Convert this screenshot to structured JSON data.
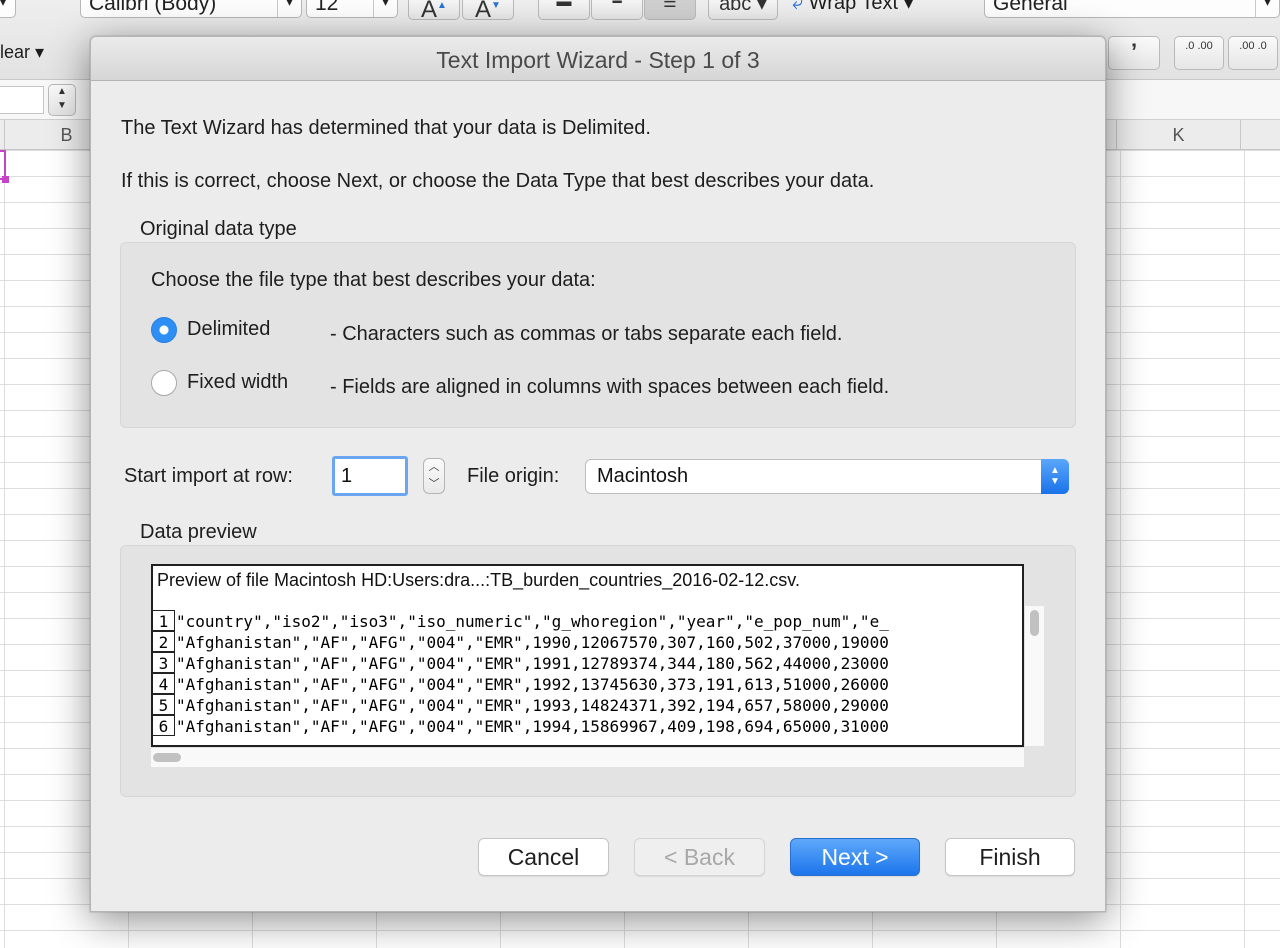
{
  "excel": {
    "ribbon": {
      "font_name": "Calibri (Body)",
      "font_size": "12",
      "grow_font": "A",
      "shrink_font": "A",
      "spelling": "abc",
      "wrap_text": "Wrap Text",
      "number_format": "General",
      "clear": "lear",
      "comma_style": "’",
      "increase_decimal": ".0 .00",
      "decrease_decimal": ".00 .0"
    },
    "column_headers": [
      "B",
      "K"
    ]
  },
  "dialog": {
    "title": "Text Import Wizard - Step 1 of 3",
    "intro_1": "The Text Wizard has determined that your data is Delimited.",
    "intro_2": "If this is correct, choose Next, or choose the Data Type that best describes your data.",
    "original_type": {
      "heading": "Original data type",
      "prompt": "Choose the file type that best describes your data:",
      "options": [
        {
          "label": "Delimited",
          "description": "- Characters such as commas or tabs separate each field.",
          "selected": true
        },
        {
          "label": "Fixed width",
          "description": "- Fields are aligned in columns with spaces between each field.",
          "selected": false
        }
      ]
    },
    "start_row": {
      "label": "Start import at row:",
      "value": "1"
    },
    "file_origin": {
      "label": "File origin:",
      "value": "Macintosh"
    },
    "preview": {
      "heading": "Data preview",
      "file_label": "Preview of file Macintosh HD:Users:dra...:TB_burden_countries_2016-02-12.csv.",
      "rows": [
        {
          "n": "1",
          "text": "\"country\",\"iso2\",\"iso3\",\"iso_numeric\",\"g_whoregion\",\"year\",\"e_pop_num\",\"e_"
        },
        {
          "n": "2",
          "text": "\"Afghanistan\",\"AF\",\"AFG\",\"004\",\"EMR\",1990,12067570,307,160,502,37000,19000"
        },
        {
          "n": "3",
          "text": "\"Afghanistan\",\"AF\",\"AFG\",\"004\",\"EMR\",1991,12789374,344,180,562,44000,23000"
        },
        {
          "n": "4",
          "text": "\"Afghanistan\",\"AF\",\"AFG\",\"004\",\"EMR\",1992,13745630,373,191,613,51000,26000"
        },
        {
          "n": "5",
          "text": "\"Afghanistan\",\"AF\",\"AFG\",\"004\",\"EMR\",1993,14824371,392,194,657,58000,29000"
        },
        {
          "n": "6",
          "text": "\"Afghanistan\",\"AF\",\"AFG\",\"004\",\"EMR\",1994,15869967,409,198,694,65000,31000"
        }
      ]
    },
    "buttons": {
      "cancel": "Cancel",
      "back": "< Back",
      "next": "Next >",
      "finish": "Finish"
    }
  },
  "colors": {
    "accent": "#1c75ec",
    "selection": "#c642c9"
  }
}
